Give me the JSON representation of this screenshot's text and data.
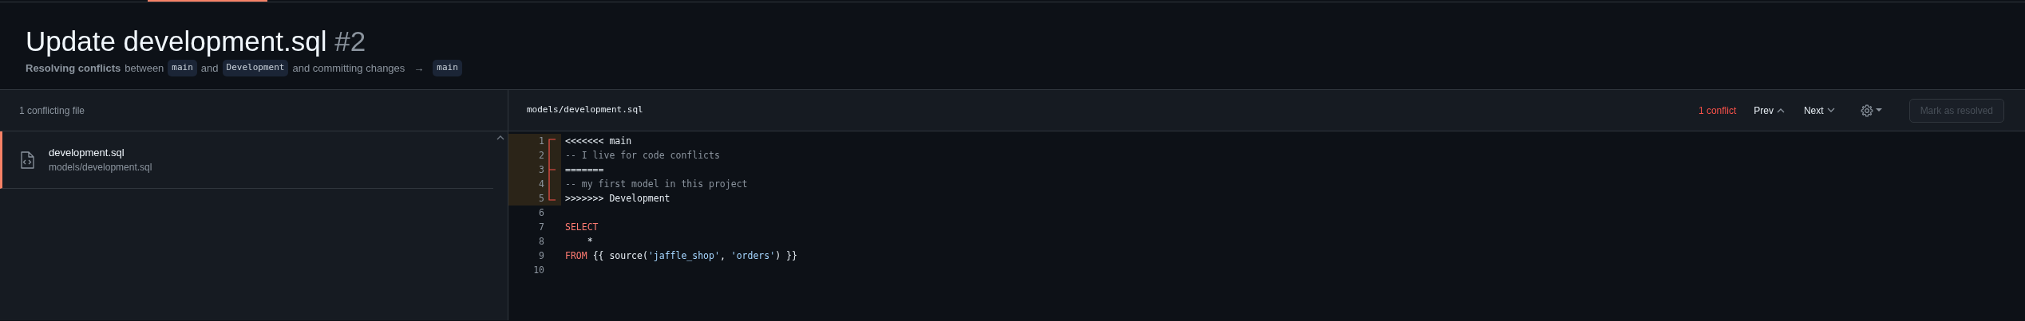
{
  "title": {
    "text": "Update development.sql",
    "number": "#2"
  },
  "subtitle": [
    {
      "kind": "bold",
      "text": "Resolving conflicts"
    },
    {
      "kind": "text",
      "text": "between"
    },
    {
      "kind": "branch",
      "text": "main"
    },
    {
      "kind": "text",
      "text": "and"
    },
    {
      "kind": "branch",
      "text": "Development"
    },
    {
      "kind": "text",
      "text": "and committing changes"
    },
    {
      "kind": "arrow",
      "text": "→"
    },
    {
      "kind": "branch",
      "text": "main"
    }
  ],
  "sidebar": {
    "heading": "1 conflicting file",
    "files": [
      {
        "name": "development.sql",
        "path": "models/development.sql",
        "selected": true
      }
    ]
  },
  "editor": {
    "path": "models/development.sql",
    "conflict_count": "1 conflict",
    "prev": "Prev",
    "next": "Next",
    "mark_resolved": {
      "label": "Mark as resolved",
      "disabled": true
    },
    "lines": [
      {
        "number": "1",
        "kind": "conflict_start",
        "tokens": [
          {
            "kind": "plain",
            "text": "<<<<<<< main"
          }
        ]
      },
      {
        "number": "2",
        "kind": "conflict_body",
        "tokens": [
          {
            "kind": "comment",
            "text": "-- I live for code conflicts"
          }
        ]
      },
      {
        "number": "3",
        "kind": "conflict_separator",
        "tokens": [
          {
            "kind": "plain",
            "text": "======="
          }
        ]
      },
      {
        "number": "4",
        "kind": "conflict_body",
        "tokens": [
          {
            "kind": "comment",
            "text": "-- my first model in this project"
          }
        ]
      },
      {
        "number": "5",
        "kind": "conflict_end",
        "tokens": [
          {
            "kind": "plain",
            "text": ">>>>>>> Development"
          }
        ]
      },
      {
        "number": "6",
        "kind": "code"
      },
      {
        "number": "7",
        "kind": "code",
        "tokens": [
          {
            "kind": "keyword",
            "text": "SELECT"
          }
        ]
      },
      {
        "number": "8",
        "kind": "code",
        "tokens": [
          {
            "kind": "plain",
            "text": "    *"
          }
        ]
      },
      {
        "number": "9",
        "kind": "code",
        "tokens": [
          {
            "kind": "keyword",
            "text": "FROM"
          },
          {
            "kind": "plain",
            "text": " {{ source("
          },
          {
            "kind": "string",
            "text": "'jaffle_shop'"
          },
          {
            "kind": "plain",
            "text": ", "
          },
          {
            "kind": "string",
            "text": "'orders'"
          },
          {
            "kind": "plain",
            "text": ") }}"
          }
        ]
      },
      {
        "number": "10",
        "kind": "code"
      }
    ]
  }
}
